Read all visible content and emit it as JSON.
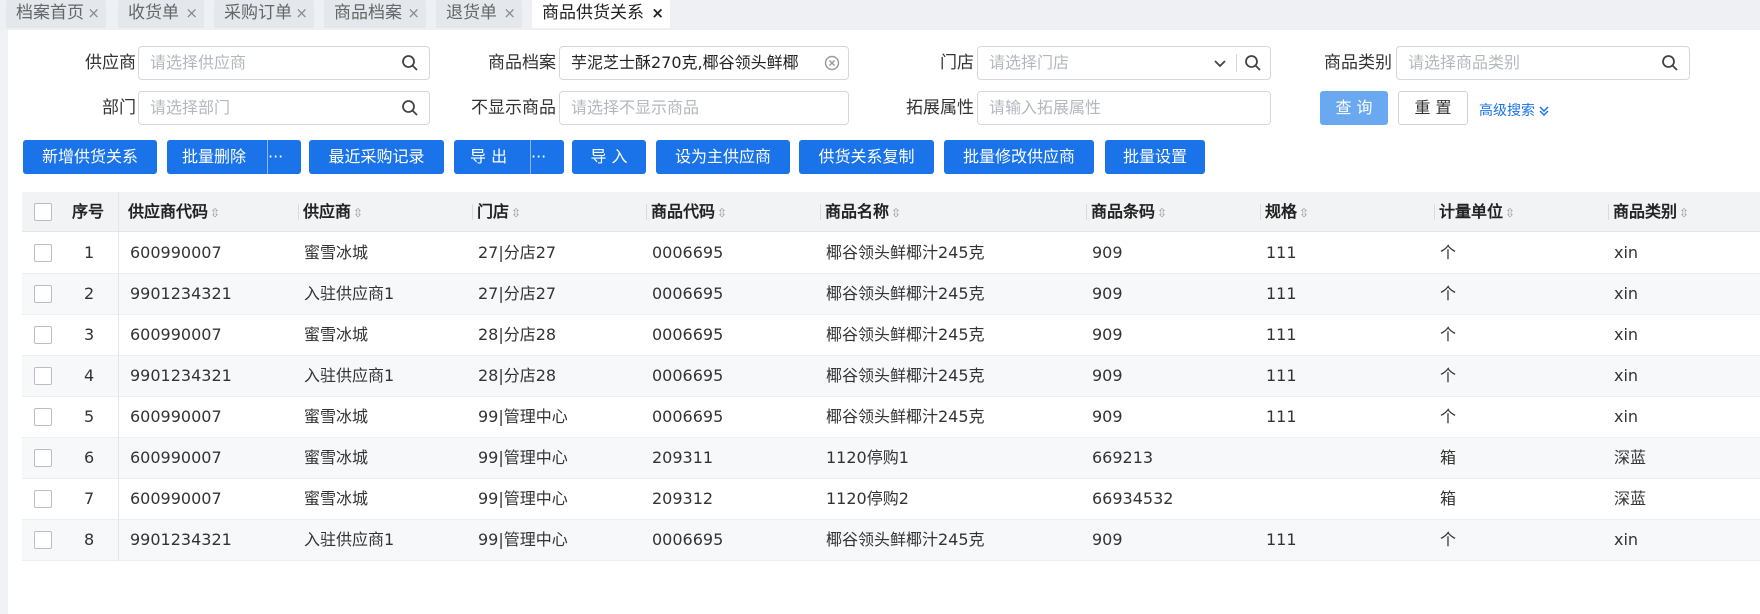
{
  "tabs": [
    {
      "label": "档案首页"
    },
    {
      "label": "收货单"
    },
    {
      "label": "采购订单"
    },
    {
      "label": "商品档案"
    },
    {
      "label": "退货单"
    },
    {
      "label": "商品供货关系"
    }
  ],
  "tab_close_glyph": "×",
  "filters": {
    "supplier": {
      "label": "供应商",
      "placeholder": "请选择供应商"
    },
    "product": {
      "label": "商品档案",
      "value": "芋泥芝士酥270克,椰谷领头鲜椰"
    },
    "store": {
      "label": "门店",
      "placeholder": "请选择门店"
    },
    "category": {
      "label": "商品类别",
      "placeholder": "请选择商品类别"
    },
    "department": {
      "label": "部门",
      "placeholder": "请选择部门"
    },
    "hidden_products": {
      "label": "不显示商品",
      "placeholder": "请选择不显示商品"
    },
    "ext_attr": {
      "label": "拓展属性",
      "placeholder": "请输入拓展属性"
    }
  },
  "actions": {
    "query": "查 询",
    "reset": "重 置",
    "advanced": "高级搜索"
  },
  "toolbar": {
    "add": "新增供货关系",
    "batch_delete": "批量删除",
    "recent": "最近采购记录",
    "export": "导 出",
    "import": "导 入",
    "set_main": "设为主供应商",
    "copy": "供货关系复制",
    "batch_modify": "批量修改供应商",
    "batch_set": "批量设置",
    "more": "···"
  },
  "table": {
    "columns": [
      "序号",
      "供应商代码",
      "供应商",
      "门店",
      "商品代码",
      "商品名称",
      "商品条码",
      "规格",
      "计量单位",
      "商品类别"
    ],
    "rows": [
      [
        "1",
        "600990007",
        "蜜雪冰城",
        "27|分店27",
        "0006695",
        "椰谷领头鲜椰汁245克",
        "909",
        "111",
        "个",
        "xin"
      ],
      [
        "2",
        "9901234321",
        "入驻供应商1",
        "27|分店27",
        "0006695",
        "椰谷领头鲜椰汁245克",
        "909",
        "111",
        "个",
        "xin"
      ],
      [
        "3",
        "600990007",
        "蜜雪冰城",
        "28|分店28",
        "0006695",
        "椰谷领头鲜椰汁245克",
        "909",
        "111",
        "个",
        "xin"
      ],
      [
        "4",
        "9901234321",
        "入驻供应商1",
        "28|分店28",
        "0006695",
        "椰谷领头鲜椰汁245克",
        "909",
        "111",
        "个",
        "xin"
      ],
      [
        "5",
        "600990007",
        "蜜雪冰城",
        "99|管理中心",
        "0006695",
        "椰谷领头鲜椰汁245克",
        "909",
        "111",
        "个",
        "xin"
      ],
      [
        "6",
        "600990007",
        "蜜雪冰城",
        "99|管理中心",
        "209311",
        "1120停购1",
        "669213",
        "",
        "箱",
        "深蓝"
      ],
      [
        "7",
        "600990007",
        "蜜雪冰城",
        "99|管理中心",
        "209312",
        "1120停购2",
        "66934532",
        "",
        "箱",
        "深蓝"
      ],
      [
        "8",
        "9901234321",
        "入驻供应商1",
        "99|管理中心",
        "0006695",
        "椰谷领头鲜椰汁245克",
        "909",
        "111",
        "个",
        "xin"
      ]
    ]
  },
  "colors": {
    "primary": "#1a73e8",
    "primary_light": "#6aa8f0"
  },
  "icons": {
    "search": "search-icon",
    "clear": "clear-icon",
    "dropdown": "chevron-down-icon",
    "sort": "sort-icon",
    "advanced": "double-chevron-down-icon"
  }
}
